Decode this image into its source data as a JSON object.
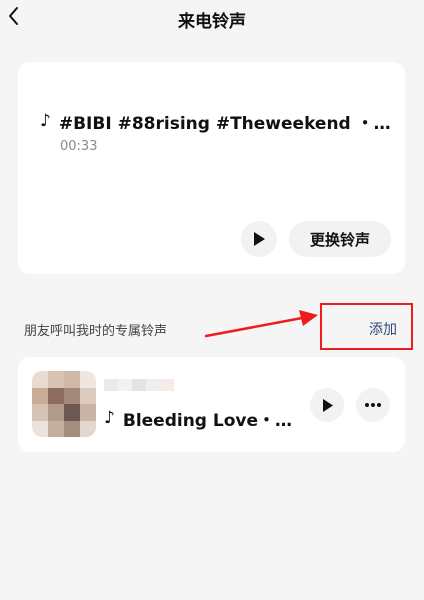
{
  "header": {
    "title": "来电铃声",
    "back_icon": "chevron-left-icon"
  },
  "current_ringtone": {
    "note_icon": "music-note-icon",
    "song_title": "#BIBI #88rising #Theweekend ・im…",
    "duration": "00:33",
    "play_icon": "play-icon",
    "change_label": "更换铃声"
  },
  "friends_section": {
    "label": "朋友呼叫我时的专属铃声",
    "add_label": "添加",
    "annotation_color": "#ee1c1c"
  },
  "friend_item": {
    "song_title": "Bleeding Love・…",
    "note_icon": "music-note-icon",
    "play_icon": "play-icon",
    "more_icon": "more-horizontal-icon"
  }
}
